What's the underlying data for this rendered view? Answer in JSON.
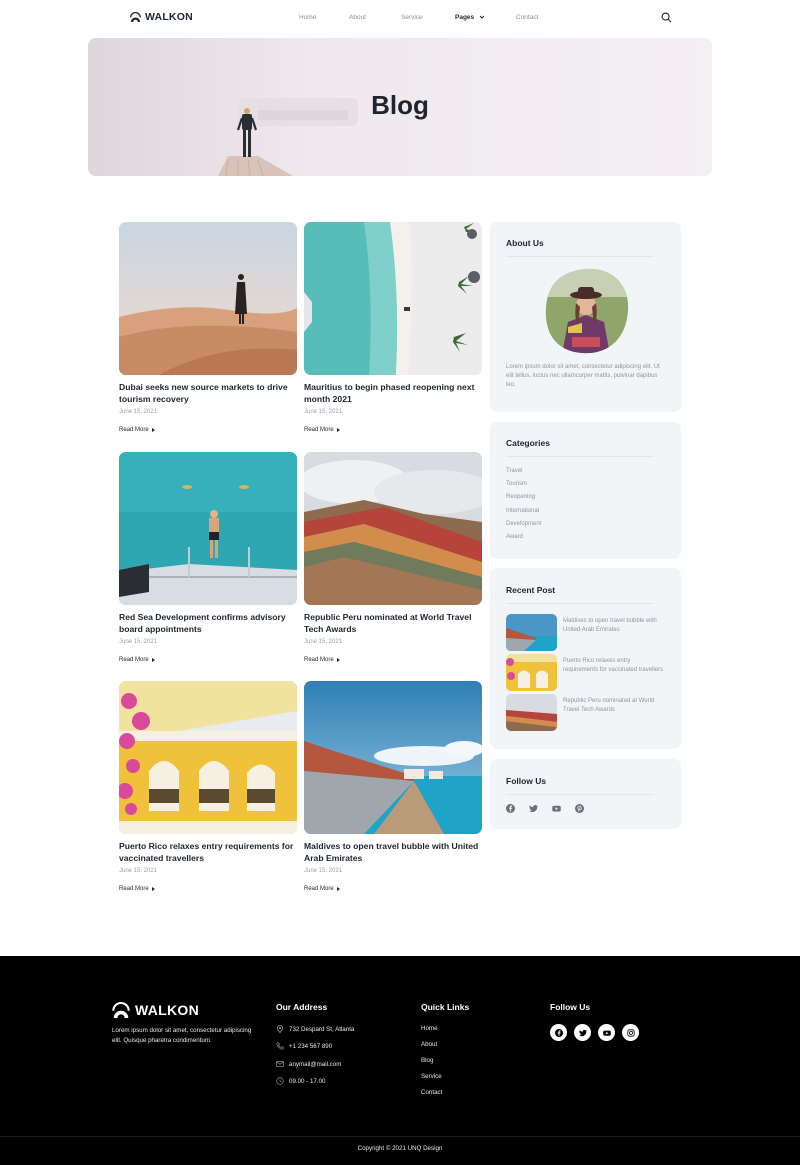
{
  "nav": {
    "logo": "WALKON",
    "links": [
      {
        "label": "Home"
      },
      {
        "label": "About"
      },
      {
        "label": "Service"
      },
      {
        "label": "Pages"
      },
      {
        "label": "Contact"
      }
    ]
  },
  "hero": {
    "title": "Blog"
  },
  "posts": [
    {
      "title": "Dubai seeks new source markets to drive tourism recovery",
      "date": "June 15, 2021",
      "more": "Read More"
    },
    {
      "title": "Mauritius to begin phased reopening next month 2021",
      "date": "June 15, 2021",
      "more": "Read More"
    },
    {
      "title": "Red Sea Development confirms advisory board appointments",
      "date": "June 15, 2021",
      "more": "Read More"
    },
    {
      "title": "Republic Peru nominated at World Travel Tech Awards",
      "date": "June 15, 2021",
      "more": "Read More"
    },
    {
      "title": "Puerto Rico relaxes entry requirements for vaccinated travellers",
      "date": "June 15, 2021",
      "more": "Read More"
    },
    {
      "title": "Maldives to open travel bubble with United Arab Emirates",
      "date": "June 15, 2021",
      "more": "Read More"
    }
  ],
  "sidebar": {
    "about": {
      "title": "About Us",
      "text": "Lorem ipsum dolor sit amet, consectetur adipiscing elit. Ut elit tellus, luctus nec ullamcorper mattis, pulvinar dapibus leo."
    },
    "categories": {
      "title": "Categories",
      "items": [
        "Travel",
        "Tourism",
        "Reopening",
        "International",
        "Development",
        "Award"
      ]
    },
    "recent": {
      "title": "Recent Post",
      "items": [
        {
          "title": "Maldives to open travel bubble with United Arab Emirates"
        },
        {
          "title": "Puerto Rico relaxes entry requirements for vaccinated travellers"
        },
        {
          "title": "Republic Peru nominated at World Travel Tech Awards"
        }
      ]
    },
    "follow": {
      "title": "Follow Us",
      "icons": [
        "facebook-icon",
        "twitter-icon",
        "youtube-icon",
        "pinterest-icon"
      ]
    }
  },
  "footer": {
    "logo": "WALKON",
    "desc": "Lorem ipsum dolor sit amet, consectetur adipiscing elit. Quisque pharetra condimentum.",
    "address_title": "Our Address",
    "address": [
      {
        "icon": "location-icon",
        "text": "732 Despard St, Atlanta"
      },
      {
        "icon": "phone-icon",
        "text": "+1 234 567 890"
      },
      {
        "icon": "mail-icon",
        "text": "anymail@mail.com"
      },
      {
        "icon": "clock-icon",
        "text": "09.00 - 17.00"
      }
    ],
    "links_title": "Quick Links",
    "links": [
      "Home",
      "About",
      "Blog",
      "Service",
      "Contact"
    ],
    "follow_title": "Follow Us",
    "social": [
      "facebook-icon",
      "twitter-icon",
      "youtube-icon",
      "instagram-icon"
    ],
    "copyright": "Copyright © 2021 UNQ Design"
  },
  "colors": {
    "text": "#1e2430",
    "muted": "#8f959d",
    "card_bg": "#f2f5f8",
    "footer_bg": "#000000"
  }
}
